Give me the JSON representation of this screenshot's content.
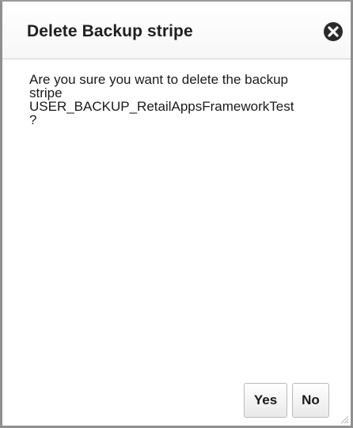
{
  "dialog": {
    "title": "Delete Backup stripe",
    "message": "Are you sure you want to delete the backup\nstripe\nUSER_BACKUP_RetailAppsFrameworkTest\n?",
    "close_icon": "close-circle-icon",
    "resize_icon": "resize-grip-icon"
  },
  "buttons": {
    "yes_label": "Yes",
    "no_label": "No"
  },
  "colors": {
    "border": "#8f8f8f",
    "title_text": "#1f1f1f",
    "close_icon": "#2a2a2a"
  }
}
